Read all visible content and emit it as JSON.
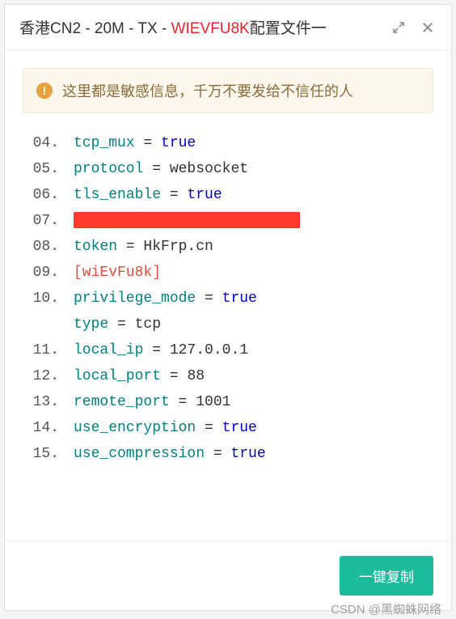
{
  "header": {
    "title_prefix": "香港CN2 - 20M - TX - ",
    "title_highlight": "WIEVFU8K",
    "title_suffix": "配置文件一"
  },
  "alert": {
    "icon_label": "!",
    "text": "这里都是敏感信息，千万不要发给不信任的人"
  },
  "code_lines": [
    {
      "num": "04",
      "tokens": [
        {
          "t": "key",
          "v": "tcp_mux"
        },
        {
          "t": "op",
          "v": " = "
        },
        {
          "t": "val",
          "v": "true"
        }
      ]
    },
    {
      "num": "05",
      "tokens": [
        {
          "t": "key",
          "v": "protocol"
        },
        {
          "t": "op",
          "v": " = "
        },
        {
          "t": "str",
          "v": "websocket"
        }
      ]
    },
    {
      "num": "06",
      "tokens": [
        {
          "t": "key",
          "v": "tls_enable"
        },
        {
          "t": "op",
          "v": " = "
        },
        {
          "t": "val",
          "v": "true"
        }
      ]
    },
    {
      "num": "07",
      "tokens": [
        {
          "t": "redact",
          "v": ""
        }
      ]
    },
    {
      "num": "08",
      "tokens": [
        {
          "t": "key",
          "v": "token"
        },
        {
          "t": "op",
          "v": " = "
        },
        {
          "t": "str",
          "v": "HkFrp.cn"
        }
      ]
    },
    {
      "num": "",
      "tokens": []
    },
    {
      "num": "09",
      "tokens": [
        {
          "t": "sec",
          "v": "[wiEvFu8k]"
        }
      ]
    },
    {
      "num": "10",
      "tokens": [
        {
          "t": "key",
          "v": "privilege_mode"
        },
        {
          "t": "op",
          "v": " = "
        },
        {
          "t": "val",
          "v": "true"
        }
      ]
    },
    {
      "num": "",
      "tokens": [
        {
          "t": "key",
          "v": "type"
        },
        {
          "t": "op",
          "v": " = "
        },
        {
          "t": "str",
          "v": "tcp"
        }
      ]
    },
    {
      "num": "11",
      "tokens": [
        {
          "t": "key",
          "v": "local_ip"
        },
        {
          "t": "op",
          "v": " = "
        },
        {
          "t": "num",
          "v": "127.0.0.1"
        }
      ]
    },
    {
      "num": "12",
      "tokens": [
        {
          "t": "key",
          "v": "local_port"
        },
        {
          "t": "op",
          "v": " = "
        },
        {
          "t": "num",
          "v": "88"
        }
      ]
    },
    {
      "num": "13",
      "tokens": [
        {
          "t": "key",
          "v": "remote_port"
        },
        {
          "t": "op",
          "v": " = "
        },
        {
          "t": "num",
          "v": "1001"
        }
      ]
    },
    {
      "num": "14",
      "tokens": [
        {
          "t": "key",
          "v": "use_encryption"
        },
        {
          "t": "op",
          "v": " = "
        },
        {
          "t": "val",
          "v": "true"
        }
      ]
    },
    {
      "num": "15",
      "tokens": [
        {
          "t": "key",
          "v": "use_compression"
        },
        {
          "t": "op",
          "v": " = "
        },
        {
          "t": "val",
          "v": "true"
        }
      ]
    }
  ],
  "footer": {
    "copy_button_label": "一键复制"
  },
  "watermark": "CSDN @黑蜘蛛网络"
}
